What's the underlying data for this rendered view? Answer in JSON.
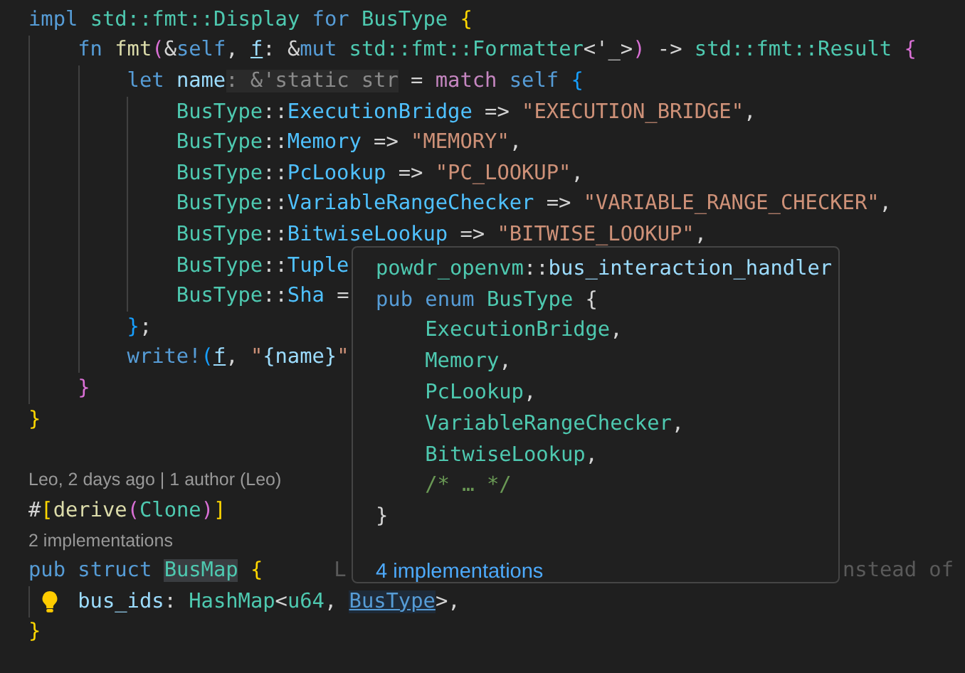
{
  "editor": {
    "lines": [
      {
        "kind": "code",
        "tokens": [
          {
            "text": "impl ",
            "kind": "keyword"
          },
          {
            "text": "std::fmt::Display ",
            "kind": "type"
          },
          {
            "text": "for ",
            "kind": "keyword"
          },
          {
            "text": "BusType ",
            "kind": "type"
          },
          {
            "text": "{",
            "kind": "brace1"
          }
        ],
        "children": [
          {
            "kind": "code",
            "tokens": [
              {
                "text": "fn ",
                "kind": "keyword"
              },
              {
                "text": "fmt",
                "kind": "function"
              },
              {
                "text": "(",
                "kind": "brace2"
              },
              {
                "text": "&",
                "kind": "punct"
              },
              {
                "text": "self",
                "kind": "keyword"
              },
              {
                "text": ", ",
                "kind": "punct"
              },
              {
                "text": "f",
                "kind": "underlined"
              },
              {
                "text": ": &",
                "kind": "punct"
              },
              {
                "text": "mut ",
                "kind": "keyword"
              },
              {
                "text": "std::fmt::Formatter",
                "kind": "type"
              },
              {
                "text": "<'_>",
                "kind": "punct"
              },
              {
                "text": ")",
                "kind": "brace2"
              },
              {
                "text": " -> ",
                "kind": "punct"
              },
              {
                "text": "std::fmt::Result ",
                "kind": "type"
              },
              {
                "text": "{",
                "kind": "brace2"
              }
            ],
            "children": [
              {
                "kind": "code",
                "tokens": [
                  {
                    "text": "let ",
                    "kind": "keyword"
                  },
                  {
                    "text": "name",
                    "kind": "variable"
                  },
                  {
                    "text": ": &'static str",
                    "kind": "hint"
                  },
                  {
                    "text": " = ",
                    "kind": "punct"
                  },
                  {
                    "text": "match ",
                    "kind": "control"
                  },
                  {
                    "text": "self ",
                    "kind": "keyword"
                  },
                  {
                    "text": "{",
                    "kind": "brace3"
                  }
                ],
                "children": [
                  {
                    "kind": "code",
                    "tokens": [
                      {
                        "text": "BusType",
                        "kind": "type"
                      },
                      {
                        "text": "::",
                        "kind": "punct"
                      },
                      {
                        "text": "ExecutionBridge",
                        "kind": "member"
                      },
                      {
                        "text": " => ",
                        "kind": "punct"
                      },
                      {
                        "text": "\"EXECUTION_BRIDGE\"",
                        "kind": "string"
                      },
                      {
                        "text": ",",
                        "kind": "punct"
                      }
                    ]
                  },
                  {
                    "kind": "code",
                    "tokens": [
                      {
                        "text": "BusType",
                        "kind": "type"
                      },
                      {
                        "text": "::",
                        "kind": "punct"
                      },
                      {
                        "text": "Memory",
                        "kind": "member"
                      },
                      {
                        "text": " => ",
                        "kind": "punct"
                      },
                      {
                        "text": "\"MEMORY\"",
                        "kind": "string"
                      },
                      {
                        "text": ",",
                        "kind": "punct"
                      }
                    ]
                  },
                  {
                    "kind": "code",
                    "tokens": [
                      {
                        "text": "BusType",
                        "kind": "type"
                      },
                      {
                        "text": "::",
                        "kind": "punct"
                      },
                      {
                        "text": "PcLookup",
                        "kind": "member"
                      },
                      {
                        "text": " => ",
                        "kind": "punct"
                      },
                      {
                        "text": "\"PC_LOOKUP\"",
                        "kind": "string"
                      },
                      {
                        "text": ",",
                        "kind": "punct"
                      }
                    ]
                  },
                  {
                    "kind": "code",
                    "tokens": [
                      {
                        "text": "BusType",
                        "kind": "type"
                      },
                      {
                        "text": "::",
                        "kind": "punct"
                      },
                      {
                        "text": "VariableRangeChecker",
                        "kind": "member"
                      },
                      {
                        "text": " => ",
                        "kind": "punct"
                      },
                      {
                        "text": "\"VARIABLE_RANGE_CHECKER\"",
                        "kind": "string"
                      },
                      {
                        "text": ",",
                        "kind": "punct"
                      }
                    ]
                  },
                  {
                    "kind": "code",
                    "tokens": [
                      {
                        "text": "BusType",
                        "kind": "type"
                      },
                      {
                        "text": "::",
                        "kind": "punct"
                      },
                      {
                        "text": "BitwiseLookup",
                        "kind": "member"
                      },
                      {
                        "text": " => ",
                        "kind": "punct"
                      },
                      {
                        "text": "\"BITWISE_LOOKUP\"",
                        "kind": "string"
                      },
                      {
                        "text": ",",
                        "kind": "punct"
                      }
                    ]
                  },
                  {
                    "kind": "code",
                    "tokens": [
                      {
                        "text": "BusType",
                        "kind": "type"
                      },
                      {
                        "text": "::",
                        "kind": "punct"
                      },
                      {
                        "text": "Tuple",
                        "kind": "member"
                      }
                    ]
                  },
                  {
                    "kind": "code",
                    "tokens": [
                      {
                        "text": "BusType",
                        "kind": "type"
                      },
                      {
                        "text": "::",
                        "kind": "punct"
                      },
                      {
                        "text": "Sha",
                        "kind": "member"
                      },
                      {
                        "text": " =",
                        "kind": "punct"
                      }
                    ]
                  }
                ]
              },
              {
                "kind": "code",
                "tokens": [
                  {
                    "text": "}",
                    "kind": "brace3"
                  },
                  {
                    "text": ";",
                    "kind": "punct"
                  }
                ]
              },
              {
                "kind": "code",
                "tokens": [
                  {
                    "text": "write!",
                    "kind": "macro"
                  },
                  {
                    "text": "(",
                    "kind": "brace3"
                  },
                  {
                    "text": "f",
                    "kind": "underlined"
                  },
                  {
                    "text": ", ",
                    "kind": "punct"
                  },
                  {
                    "text": "\"",
                    "kind": "string"
                  },
                  {
                    "text": "{name}",
                    "kind": "variable"
                  },
                  {
                    "text": "\"",
                    "kind": "string"
                  }
                ]
              }
            ]
          },
          {
            "kind": "code",
            "tokens": [
              {
                "text": "}",
                "kind": "brace2"
              }
            ]
          }
        ]
      },
      {
        "kind": "code",
        "tokens": [
          {
            "text": "}",
            "kind": "brace1"
          }
        ]
      },
      {
        "kind": "blank"
      },
      {
        "kind": "codelens",
        "text": "Leo, 2 days ago | 1 author (Leo)"
      },
      {
        "kind": "code",
        "tokens": [
          {
            "text": "#",
            "kind": "punct"
          },
          {
            "text": "[",
            "kind": "brace1"
          },
          {
            "text": "derive",
            "kind": "function"
          },
          {
            "text": "(",
            "kind": "brace2"
          },
          {
            "text": "Clone",
            "kind": "type"
          },
          {
            "text": ")",
            "kind": "brace2"
          },
          {
            "text": "]",
            "kind": "brace1"
          }
        ]
      },
      {
        "kind": "codelens",
        "text": "2 implementations"
      },
      {
        "kind": "code",
        "tokens": [
          {
            "text": "pub ",
            "kind": "keyword"
          },
          {
            "text": "struct ",
            "kind": "keyword"
          },
          {
            "text": "BusMap",
            "kind": "highlighted"
          },
          {
            "text": " {",
            "kind": "brace1"
          }
        ],
        "annotations": [
          "L",
          "nstead of"
        ],
        "children": [
          {
            "kind": "lightbulb-code",
            "tokens": [
              {
                "text": "bus_ids",
                "kind": "variable"
              },
              {
                "text": ": ",
                "kind": "punct"
              },
              {
                "text": "HashMap",
                "kind": "type"
              },
              {
                "text": "<",
                "kind": "punct"
              },
              {
                "text": "u64",
                "kind": "type"
              },
              {
                "text": ", ",
                "kind": "punct"
              },
              {
                "text": "BusType",
                "kind": "link"
              },
              {
                "text": ">,",
                "kind": "punct"
              }
            ]
          }
        ]
      },
      {
        "kind": "code",
        "tokens": [
          {
            "text": "}",
            "kind": "brace1"
          }
        ]
      }
    ]
  },
  "hover": {
    "lines": [
      {
        "kind": "code",
        "tokens": [
          {
            "text": "powdr_openvm",
            "kind": "type"
          },
          {
            "text": "::",
            "kind": "punct"
          },
          {
            "text": "bus_interaction_handler",
            "kind": "variable"
          }
        ]
      },
      {
        "kind": "code",
        "tokens": [
          {
            "text": "pub ",
            "kind": "keyword"
          },
          {
            "text": "enum ",
            "kind": "keyword"
          },
          {
            "text": "BusType ",
            "kind": "type"
          },
          {
            "text": "{",
            "kind": "punct"
          }
        ],
        "children": [
          {
            "kind": "code",
            "tokens": [
              {
                "text": "ExecutionBridge",
                "kind": "type"
              },
              {
                "text": ",",
                "kind": "punct"
              }
            ]
          },
          {
            "kind": "code",
            "tokens": [
              {
                "text": "Memory",
                "kind": "type"
              },
              {
                "text": ",",
                "kind": "punct"
              }
            ]
          },
          {
            "kind": "code",
            "tokens": [
              {
                "text": "PcLookup",
                "kind": "type"
              },
              {
                "text": ",",
                "kind": "punct"
              }
            ]
          },
          {
            "kind": "code",
            "tokens": [
              {
                "text": "VariableRangeChecker",
                "kind": "type"
              },
              {
                "text": ",",
                "kind": "punct"
              }
            ]
          },
          {
            "kind": "code",
            "tokens": [
              {
                "text": "BitwiseLookup",
                "kind": "type"
              },
              {
                "text": ",",
                "kind": "punct"
              }
            ]
          },
          {
            "kind": "code",
            "tokens": [
              {
                "text": "/* … */",
                "kind": "comment"
              }
            ]
          }
        ]
      },
      {
        "kind": "code",
        "tokens": [
          {
            "text": "}",
            "kind": "punct"
          }
        ]
      }
    ],
    "link": "4 implementations"
  }
}
